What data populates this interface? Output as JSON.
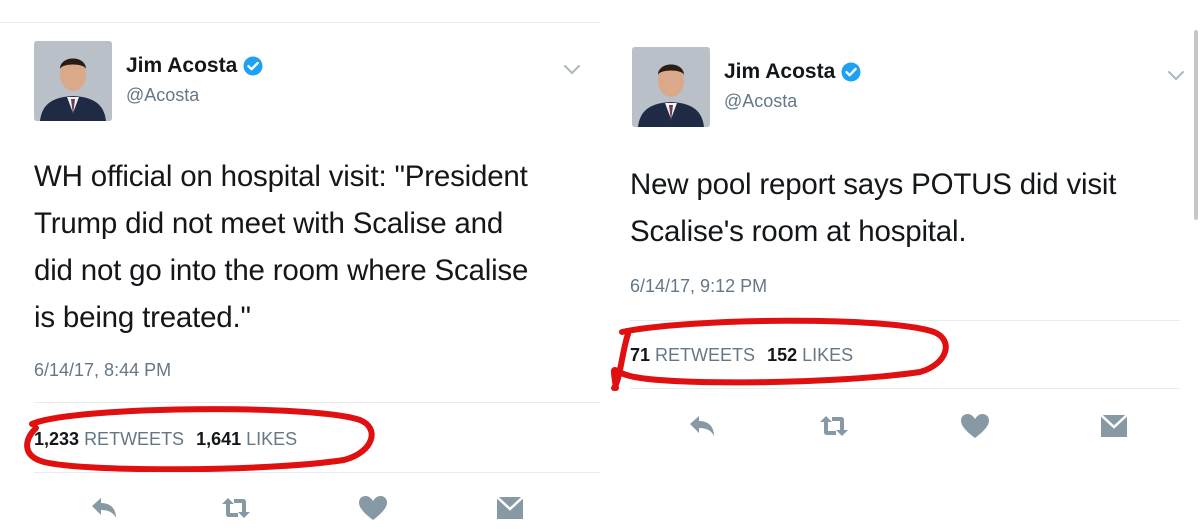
{
  "colors": {
    "text_primary": "#14171a",
    "text_secondary": "#657786",
    "verified_blue": "#1da1f2",
    "annotation_red": "#e01010",
    "icon_gray": "#8899a6"
  },
  "tweets": [
    {
      "user": {
        "name": "Jim Acosta",
        "handle": "@Acosta"
      },
      "text_lines": [
        "WH official on hospital visit: \"President",
        "Trump did not meet with Scalise and",
        "did not go into the room where Scalise",
        "is being treated.\""
      ],
      "timestamp": "6/14/17, 8:44 PM",
      "stats": {
        "retweets_count": "1,233",
        "retweets_label": "RETWEETS",
        "likes_count": "1,641",
        "likes_label": "LIKES"
      },
      "actions": [
        "reply-icon",
        "retweet-icon",
        "heart-icon",
        "dm-icon"
      ]
    },
    {
      "user": {
        "name": "Jim Acosta",
        "handle": "@Acosta"
      },
      "text_lines": [
        "New pool report says POTUS did visit",
        "Scalise's room at hospital."
      ],
      "timestamp": "6/14/17, 9:12 PM",
      "stats": {
        "retweets_count": "71",
        "retweets_label": "RETWEETS",
        "likes_count": "152",
        "likes_label": "LIKES"
      },
      "actions": [
        "reply-icon",
        "retweet-icon",
        "heart-icon",
        "dm-icon"
      ]
    }
  ]
}
